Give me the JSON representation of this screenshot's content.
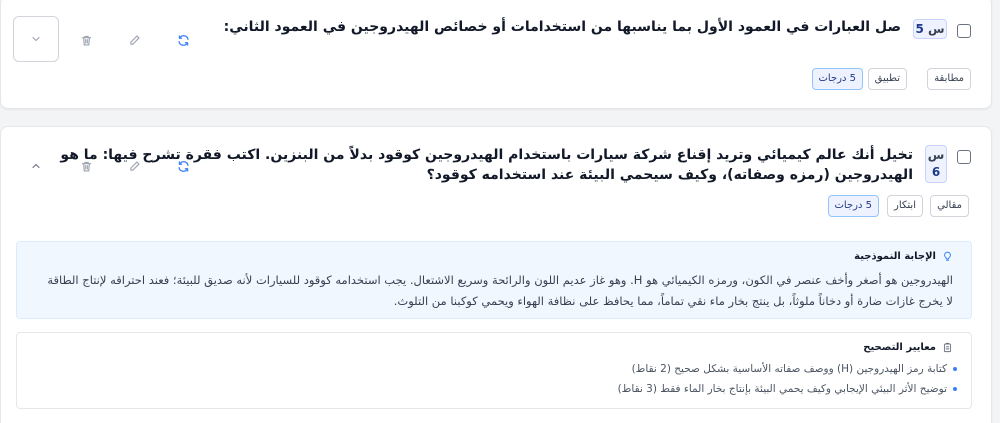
{
  "questions": [
    {
      "number_prefix": "س",
      "number": "5",
      "text": "صل العبارات في العمود الأول بما يناسبها من استخدامات أو خصائص الهيدروجين في العمود الثاني:",
      "tags": {
        "type": "مطابقة",
        "level": "تطبيق",
        "grade": "5 درجات"
      }
    },
    {
      "number_prefix": "س",
      "number": "6",
      "text_line1": "تخيل أنك عالم كيميائي وتريد إقناع شركة سيارات باستخدام الهيدروجين كوقود بدلاً من البنزين. اكتب فقرة تشرح فيها: ما هو",
      "text_line2": "الهيدروجين (رمزه وصفاته)، وكيف سيحمي البيئة عند استخدامه كوقود؟",
      "tags": {
        "type": "مقالي",
        "level": "ابتكار",
        "grade": "5 درجات"
      },
      "model_answer": {
        "title": "الإجابة النموذجية",
        "line1": "الهيدروجين هو أصغر وأخف عنصر في الكون، ورمزه الكيميائي هو H. وهو غاز عديم اللون والرائحة وسريع الاشتعال. يجب استخدامه كوقود للسيارات لأنه صديق للبيئة؛ فعند احتراقه لإنتاج الطاقة",
        "line2": "لا يخرج غازات ضارة أو دخاناً ملوثاً، بل ينتج بخار ماء نقي تماماً، مما يحافظ على نظافة الهواء ويحمي كوكبنا من التلوث."
      },
      "criteria": {
        "title": "معايير التصحيح",
        "items": [
          "كتابة رمز الهيدروجين (H) ووصف صفاته الأساسية بشكل صحيح (2 نقاط)",
          "توضيح الأثر البيئي الإيجابي وكيف يحمي البيئة بإنتاج بخار الماء فقط (3 نقاط)"
        ]
      }
    }
  ],
  "icons": {
    "refresh": "refresh-icon",
    "edit": "pencil-icon",
    "delete": "trash-icon",
    "expand": "chevron-down-icon",
    "collapse": "chevron-up-icon",
    "model": "lightbulb-icon",
    "criteria": "clipboard-icon"
  },
  "colors": {
    "accent": "#3b82f6",
    "badge_bg": "#eef2ff",
    "model_bg": "#f0f7ff"
  }
}
